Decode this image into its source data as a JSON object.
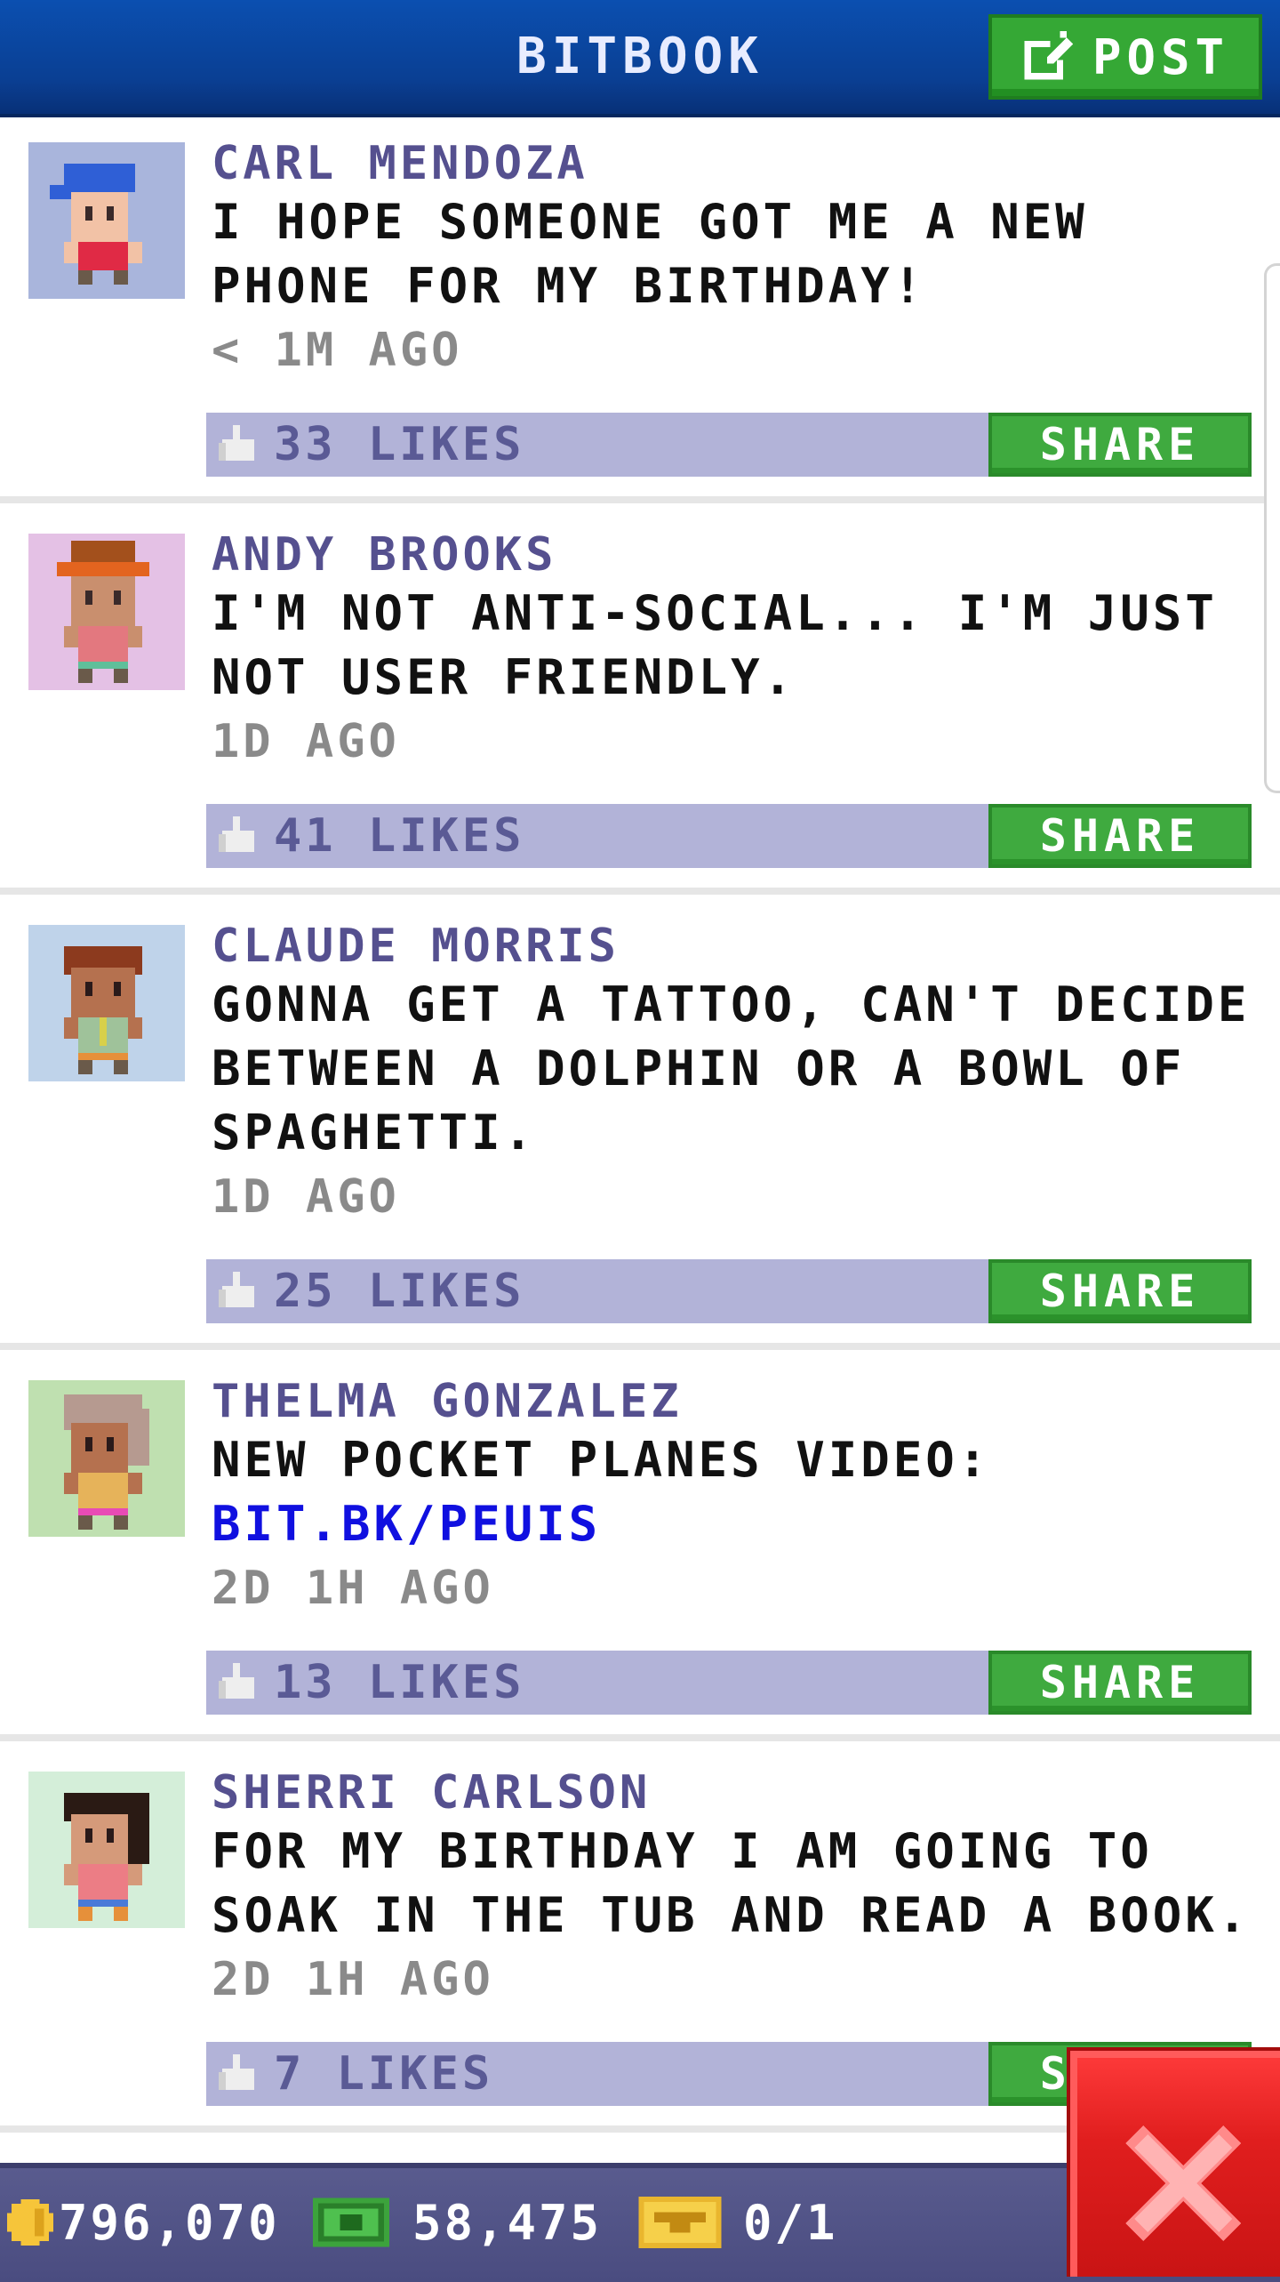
{
  "header": {
    "title": "BITBOOK",
    "post_label": "POST"
  },
  "posts": [
    {
      "author": "CARL MENDOZA",
      "message": "I HOPE SOMEONE GOT ME A NEW PHONE FOR MY BIRTHDAY!",
      "time": "< 1M AGO",
      "likes": "33 LIKES",
      "share": "SHARE",
      "avatar_bg": "#a9b5dc"
    },
    {
      "author": "ANDY BROOKS",
      "message": "I'M NOT ANTI-SOCIAL... I'M JUST NOT USER FRIENDLY.",
      "time": "1D AGO",
      "likes": "41 LIKES",
      "share": "SHARE",
      "avatar_bg": "#e4c1e5"
    },
    {
      "author": "CLAUDE MORRIS",
      "message": "GONNA GET A TATTOO, CAN'T DECIDE BETWEEN A DOLPHIN OR A BOWL OF SPAGHETTI.",
      "time": "1D AGO",
      "likes": "25 LIKES",
      "share": "SHARE",
      "avatar_bg": "#bfd3ea"
    },
    {
      "author": "THELMA GONZALEZ",
      "message": "NEW POCKET PLANES VIDEO:",
      "link": "BIT.BK/PEUIS",
      "time": "2D 1H AGO",
      "likes": "13 LIKES",
      "share": "SHARE",
      "avatar_bg": "#bfe0b0"
    },
    {
      "author": "SHERRI CARLSON",
      "message": "FOR MY BIRTHDAY I AM GOING TO SOAK IN THE TUB AND READ A BOOK.",
      "time": "2D 1H AGO",
      "likes": "7 LIKES",
      "share": "SHARE",
      "avatar_bg": "#d4eed9"
    }
  ],
  "status": {
    "coins": "796,070",
    "bux": "58,475",
    "tickets": "0/1"
  },
  "colors": {
    "header": "#0a3f93",
    "share_green": "#3faa3f",
    "like_bar": "#b2b3d8",
    "author": "#55508f",
    "link": "#1010e0",
    "close_red": "#e01e1e"
  },
  "icons": {
    "post": "edit-icon",
    "like": "thumbs-up-icon",
    "coin": "coin-icon",
    "bux": "cash-icon",
    "ticket": "ticket-icon",
    "close": "close-icon"
  }
}
